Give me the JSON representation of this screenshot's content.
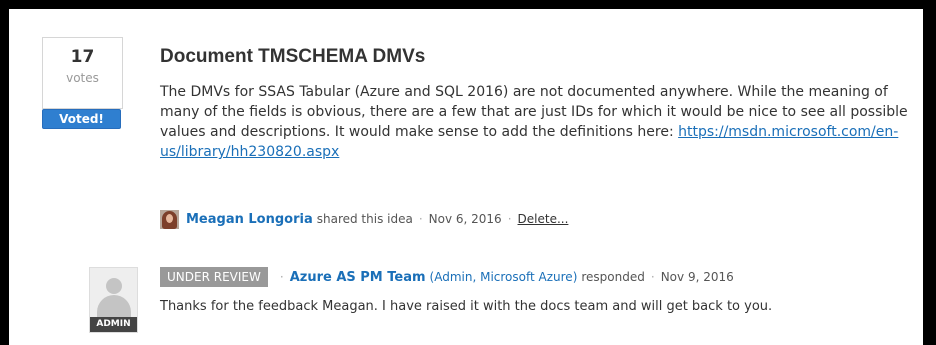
{
  "idea": {
    "votes_count": "17",
    "votes_label": "votes",
    "voted_label": "Voted!",
    "title": "Document TMSCHEMA DMVs",
    "description": "The DMVs for SSAS Tabular (Azure and SQL 2016) are not documented anywhere. While the meaning of many of the fields is obvious, there are a few that are just IDs for which it would be nice to see all possible values and descriptions. It would make sense to add the definitions here: ",
    "link_text": "https://msdn.microsoft.com/en-us/library/hh230820.aspx",
    "author_name": "Meagan Longoria",
    "shared_text": "shared this idea",
    "separator": "·",
    "date": "Nov 6, 2016",
    "delete_label": "Delete..."
  },
  "response": {
    "status": "UNDER REVIEW",
    "separator": "·",
    "team_name": "Azure AS PM Team",
    "team_role": "(Admin, Microsoft Azure)",
    "responded_text": "responded",
    "date": "Nov 9, 2016",
    "admin_badge": "ADMIN",
    "text": "Thanks for the feedback Meagan. I have raised it with the docs team and will get back to you."
  },
  "colors": {
    "link": "#1a6fb8",
    "voted_button": "#2f7fd0",
    "status_badge": "#999999",
    "frame_border": "#000000"
  },
  "icons": {
    "author_avatar": "user-photo-avatar",
    "admin_avatar": "default-user-silhouette"
  }
}
